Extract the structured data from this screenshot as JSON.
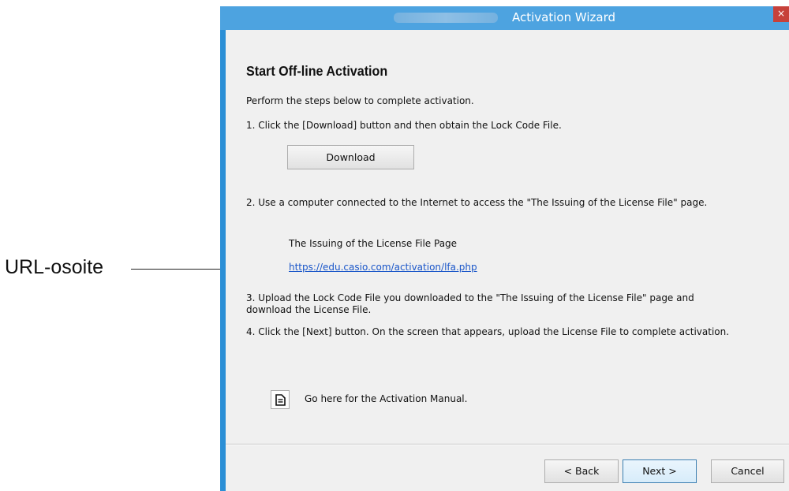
{
  "callout": {
    "label": "URL-osoite"
  },
  "window": {
    "title": "Activation Wizard",
    "close_glyph": "×"
  },
  "content": {
    "heading": "Start Off-line Activation",
    "intro": "Perform the steps below to complete activation.",
    "step1": "1. Click the [Download] button and then obtain the Lock Code File.",
    "download_label": "Download",
    "step2": "2. Use a computer connected to the Internet to access the \"The Issuing of the License File\" page.",
    "page_name": "The Issuing of the License File Page",
    "url": "https://edu.casio.com/activation/lfa.php",
    "step3": "3. Upload the Lock Code File you downloaded to the \"The Issuing of the License File\" page and download the License File.",
    "step4": "4. Click the [Next] button. On the screen that appears, upload the License File to complete activation.",
    "manual_text": "Go here for the Activation Manual.",
    "manual_icon": "document-icon"
  },
  "footer": {
    "back_label": "< Back",
    "next_label": "Next >",
    "cancel_label": "Cancel"
  },
  "colors": {
    "titlebar": "#4da3e0",
    "link": "#1a56c9",
    "close": "#c7413a"
  }
}
